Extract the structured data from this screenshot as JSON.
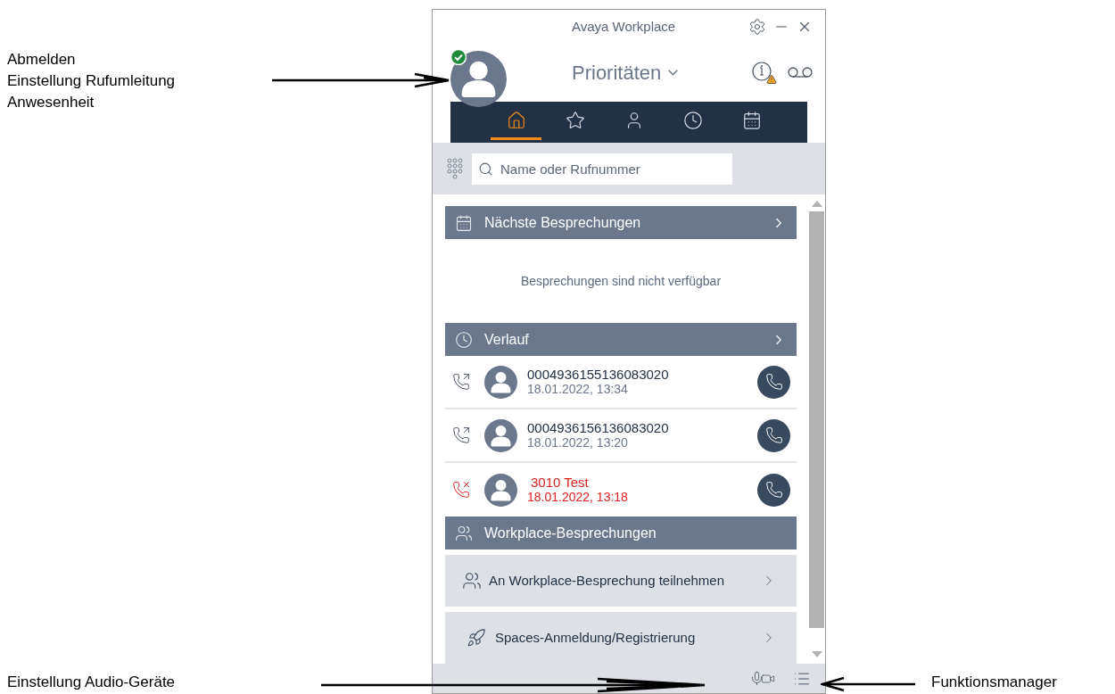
{
  "annotations": {
    "avatar_menu": [
      "Abmelden",
      "Einstellung Rufumleitung",
      "Anwesenheit"
    ],
    "audio_devices": "Einstellung Audio-Geräte",
    "feature_manager": "Funktionsmanager"
  },
  "window": {
    "title": "Avaya Workplace"
  },
  "user": {
    "online": true
  },
  "header": {
    "title": "Prioritäten",
    "info_warning": true
  },
  "tabs": [
    {
      "kind": "home",
      "selected": true
    },
    {
      "kind": "favorites",
      "selected": false
    },
    {
      "kind": "contacts",
      "selected": false
    },
    {
      "kind": "history",
      "selected": false
    },
    {
      "kind": "calendar",
      "selected": false
    }
  ],
  "search": {
    "placeholder": "Name oder Rufnummer"
  },
  "meetings": {
    "title": "Nächste Besprechungen",
    "empty_text": "Besprechungen sind nicht verfügbar"
  },
  "history": {
    "title": "Verlauf",
    "rows": [
      {
        "kind": "outgoing",
        "name": "0004936155136083020",
        "time": "18.01.2022, 13:34"
      },
      {
        "kind": "outgoing",
        "name": "0004936156136083020",
        "time": "18.01.2022, 13:20"
      },
      {
        "kind": "missed",
        "name": "3010 Test",
        "time": "18.01.2022, 13:18"
      }
    ]
  },
  "workplace": {
    "title": "Workplace-Besprechungen",
    "actions": [
      {
        "kind": "join",
        "label": "An Workplace-Besprechung teilnehmen"
      },
      {
        "kind": "spaces",
        "label": "Spaces-Anmeldung/Registrierung"
      }
    ]
  }
}
